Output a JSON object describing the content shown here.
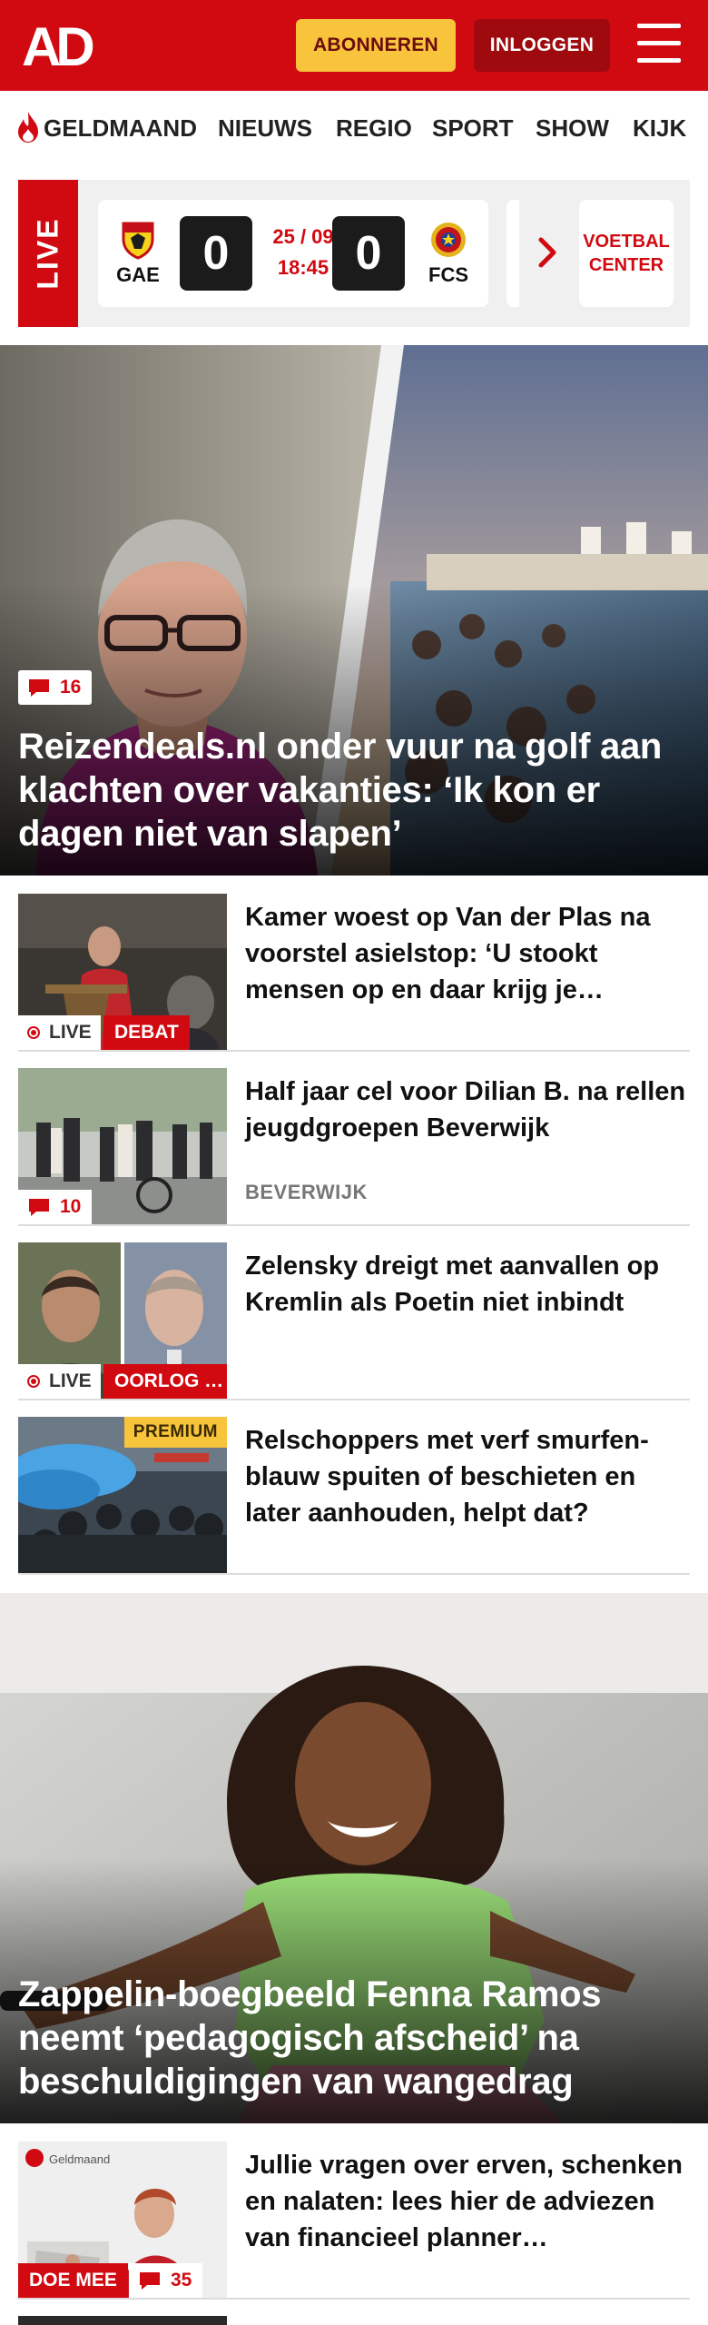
{
  "header": {
    "logo_text": "AD",
    "subscribe_label": "ABONNEREN",
    "login_label": "INLOGGEN",
    "colors": {
      "brand_red": "#d10a11",
      "subscribe_yellow": "#f8c43c",
      "login_dark_red": "#9e0a0e"
    }
  },
  "nav": {
    "items": [
      "GELDMAAND",
      "NIEUWS",
      "REGIO",
      "SPORT",
      "SHOW",
      "KIJK"
    ],
    "first_item_icon": "flame-icon"
  },
  "live_bar": {
    "badge": "LIVE",
    "match": {
      "home_team": "GAE",
      "away_team": "FCS",
      "home_score": "0",
      "away_score": "0",
      "date": "25 / 09",
      "time": "18:45"
    },
    "voetbal_center_line1": "VOETBAL",
    "voetbal_center_line2": "CENTER"
  },
  "hero": {
    "comments": "16",
    "title": "Reizendeals.nl onder vuur na golf aan klachten over vakanties: ‘Ik kon er dagen niet van slapen’"
  },
  "articles": [
    {
      "title": "Kamer woest op Van der Plas na voorstel asielstop: ‘U stookt mensen op en daar krijg je…",
      "live_label": "LIVE",
      "tag": "DEBAT"
    },
    {
      "title": "Half jaar cel voor Dilian B. na rellen jeugdgroepen Beverwijk",
      "comments": "10",
      "meta": "BEVERWIJK"
    },
    {
      "title": "Zelensky dreigt met aanvallen op Kremlin als Poetin niet inbindt",
      "live_label": "LIVE",
      "tag": "OORLOG …"
    },
    {
      "title": "Relschoppers met verf smurfen-blauw spuiten of beschieten en later aanhouden, helpt dat?",
      "premium": "PREMIUM"
    }
  ],
  "hero2": {
    "title": "Zappelin-boegbeeld Fenna Ramos neemt ‘pedagogisch afscheid’ na beschuldigingen van wangedrag"
  },
  "article5": {
    "title": "Jullie vragen over erven, schenken en nalaten: lees hier de adviezen van financieel planner…",
    "tag": "DOE MEE",
    "comments": "35",
    "thumb_brand": "Geldmaand"
  }
}
